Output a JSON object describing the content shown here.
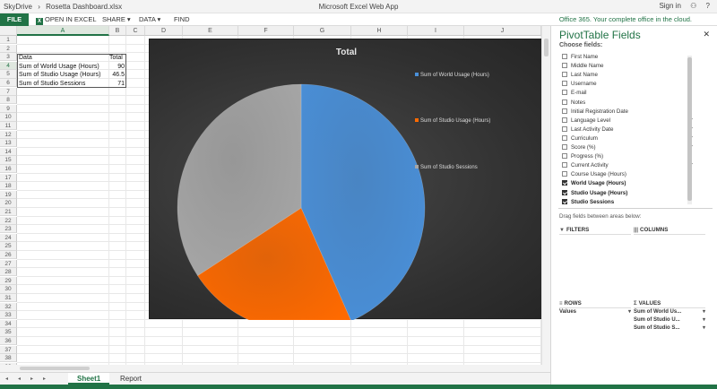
{
  "titlebar": {
    "breadcrumb": [
      "SkyDrive",
      "›",
      "Rosetta Dashboard.xlsx"
    ],
    "app_title": "Microsoft Excel Web App",
    "sign_in": "Sign in",
    "help": "?"
  },
  "ribbon": {
    "file": "FILE",
    "open_in_excel": "OPEN IN EXCEL",
    "share": "SHARE ▾",
    "data": "DATA ▾",
    "find": "FIND",
    "promo": "Office 365. Your complete office in the cloud."
  },
  "grid": {
    "columns": [
      "A",
      "B",
      "C",
      "D",
      "E",
      "F",
      "G",
      "H",
      "I",
      "J"
    ],
    "rows": [
      "1",
      "2",
      "3",
      "4",
      "5",
      "6",
      "7",
      "8",
      "9",
      "10",
      "11",
      "12",
      "13",
      "14",
      "15",
      "16",
      "17",
      "18",
      "19",
      "20",
      "21",
      "22",
      "23",
      "24",
      "25",
      "26",
      "27",
      "28",
      "29",
      "30",
      "31",
      "32",
      "33",
      "34",
      "35",
      "36",
      "37",
      "38",
      "39"
    ],
    "table": {
      "header": [
        "Data",
        "Total"
      ],
      "rows": [
        [
          "Sum of World Usage (Hours)",
          "90"
        ],
        [
          "Sum of Studio Usage (Hours)",
          "46.5"
        ],
        [
          "Sum of Studio Sessions",
          "71"
        ]
      ]
    }
  },
  "chart_data": {
    "type": "pie",
    "title": "Total",
    "categories": [
      "Sum of World Usage (Hours)",
      "Sum of Studio Usage (Hours)",
      "Sum of Studio Sessions"
    ],
    "values": [
      90,
      46.5,
      71
    ],
    "colors": [
      "#4a90d9",
      "#ff6a00",
      "#a6a6a6"
    ],
    "legend": "right"
  },
  "sheets": {
    "tabs": [
      "Sheet1",
      "Report"
    ],
    "active": "Sheet1",
    "nav": [
      "◂",
      "◂",
      "▸",
      "▸"
    ]
  },
  "pivot": {
    "title": "PivotTable Fields",
    "close": "✕",
    "choose_fields": "Choose fields:",
    "fields": [
      {
        "label": "First Name",
        "checked": false,
        "filter": false
      },
      {
        "label": "Middle Name",
        "checked": false,
        "filter": false
      },
      {
        "label": "Last Name",
        "checked": false,
        "filter": false
      },
      {
        "label": "Username",
        "checked": false,
        "filter": false
      },
      {
        "label": "E-mail",
        "checked": false,
        "filter": false
      },
      {
        "label": "Notes",
        "checked": false,
        "filter": false
      },
      {
        "label": "Initial Registration Date",
        "checked": false,
        "filter": false
      },
      {
        "label": "Language Level",
        "checked": false,
        "filter": true
      },
      {
        "label": "Last Activity Date",
        "checked": false,
        "filter": true
      },
      {
        "label": "Curriculum",
        "checked": false,
        "filter": true
      },
      {
        "label": "Score (%)",
        "checked": false,
        "filter": true
      },
      {
        "label": "Progress (%)",
        "checked": false,
        "filter": false
      },
      {
        "label": "Current Activity",
        "checked": false,
        "filter": true
      },
      {
        "label": "Course Usage (Hours)",
        "checked": false,
        "filter": false
      },
      {
        "label": "World Usage (Hours)",
        "checked": true,
        "filter": false
      },
      {
        "label": "Studio Usage (Hours)",
        "checked": true,
        "filter": false
      },
      {
        "label": "Studio Sessions",
        "checked": true,
        "filter": false
      }
    ],
    "drag_hint": "Drag fields between areas below:",
    "filters_label": "FILTERS",
    "columns_label": "COLUMNS",
    "rows_label": "ROWS",
    "values_label": "VALUES",
    "rows_items": [
      "Values"
    ],
    "values_items": [
      "Sum of World Us...",
      "Sum of Studio U...",
      "Sum of Studio S..."
    ]
  },
  "colors": {
    "accent": "#217346"
  }
}
